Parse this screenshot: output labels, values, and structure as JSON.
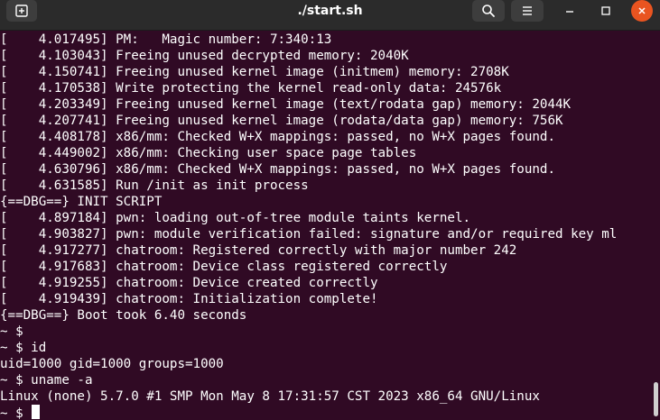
{
  "window": {
    "title": "./start.sh"
  },
  "icons": {
    "new_tab": "new-tab-icon",
    "search": "search-icon",
    "menu": "hamburger-menu-icon",
    "minimize": "minimize-icon",
    "maximize": "maximize-icon",
    "close": "close-icon"
  },
  "colors": {
    "terminal_background": "#300a24",
    "terminal_text": "#ffffff",
    "titlebar_background": "#2b2b2b",
    "close_button": "#e95420"
  },
  "terminal": {
    "lines": [
      "[    4.017495] PM:   Magic number: 7:340:13",
      "[    4.103043] Freeing unused decrypted memory: 2040K",
      "[    4.150741] Freeing unused kernel image (initmem) memory: 2708K",
      "[    4.170538] Write protecting the kernel read-only data: 24576k",
      "[    4.203349] Freeing unused kernel image (text/rodata gap) memory: 2044K",
      "[    4.207741] Freeing unused kernel image (rodata/data gap) memory: 756K",
      "[    4.408178] x86/mm: Checked W+X mappings: passed, no W+X pages found.",
      "[    4.449002] x86/mm: Checking user space page tables",
      "[    4.630796] x86/mm: Checked W+X mappings: passed, no W+X pages found.",
      "[    4.631585] Run /init as init process",
      "{==DBG==} INIT SCRIPT",
      "[    4.897184] pwn: loading out-of-tree module taints kernel.",
      "[    4.903827] pwn: module verification failed: signature and/or required key ml",
      "[    4.917277] chatroom: Registered correctly with major number 242",
      "[    4.917683] chatroom: Device class registered correctly",
      "[    4.919255] chatroom: Device created correctly",
      "[    4.919439] chatroom: Initialization complete!",
      "{==DBG==} Boot took 6.40 seconds",
      "~ $",
      "~ $ id",
      "uid=1000 gid=1000 groups=1000",
      "~ $ uname -a",
      "Linux (none) 5.7.0 #1 SMP Mon May 8 17:31:57 CST 2023 x86_64 GNU/Linux"
    ],
    "prompt": "~ $ "
  }
}
